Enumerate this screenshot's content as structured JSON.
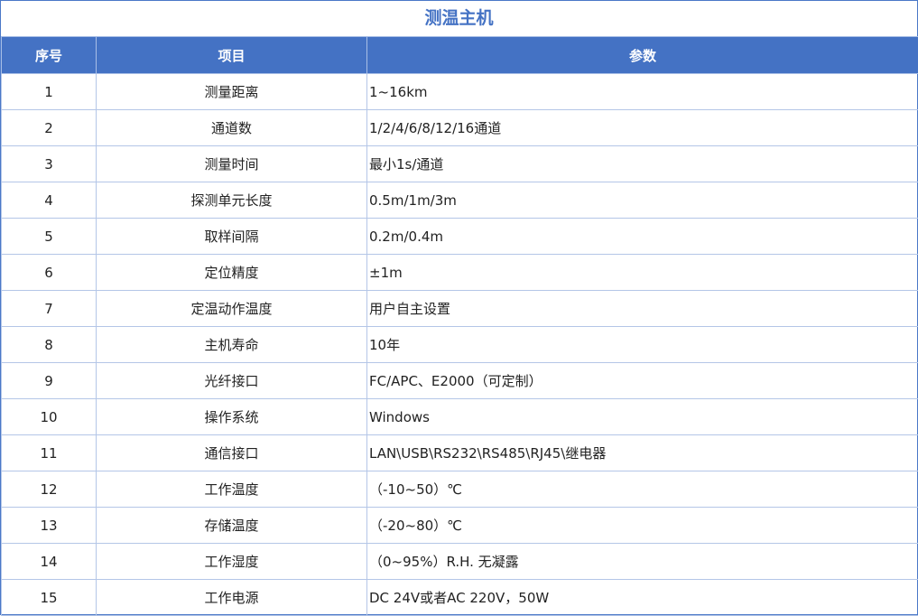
{
  "title": "测温主机",
  "headers": {
    "no": "序号",
    "item": "项目",
    "param": "参数"
  },
  "rows": [
    {
      "no": "1",
      "item": "测量距离",
      "param": "1~16km"
    },
    {
      "no": "2",
      "item": "通道数",
      "param": "1/2/4/6/8/12/16通道"
    },
    {
      "no": "3",
      "item": "测量时间",
      "param": "最小1s/通道"
    },
    {
      "no": "4",
      "item": "探测单元长度",
      "param": "0.5m/1m/3m"
    },
    {
      "no": "5",
      "item": "取样间隔",
      "param": "0.2m/0.4m"
    },
    {
      "no": "6",
      "item": "定位精度",
      "param": "±1m"
    },
    {
      "no": "7",
      "item": "定温动作温度",
      "param": "用户自主设置"
    },
    {
      "no": "8",
      "item": "主机寿命",
      "param": "10年"
    },
    {
      "no": "9",
      "item": "光纤接口",
      "param": "FC/APC、E2000（可定制）"
    },
    {
      "no": "10",
      "item": "操作系统",
      "param": "Windows"
    },
    {
      "no": "11",
      "item": "通信接口",
      "param": "LAN\\USB\\RS232\\RS485\\RJ45\\继电器"
    },
    {
      "no": "12",
      "item": "工作温度",
      "param": "（-10~50）℃"
    },
    {
      "no": "13",
      "item": "存储温度",
      "param": "（-20~80）℃"
    },
    {
      "no": "14",
      "item": "工作湿度",
      "param": "（0~95%）R.H. 无凝露"
    },
    {
      "no": "15",
      "item": "工作电源",
      "param": "DC 24V或者AC 220V，50W"
    }
  ]
}
